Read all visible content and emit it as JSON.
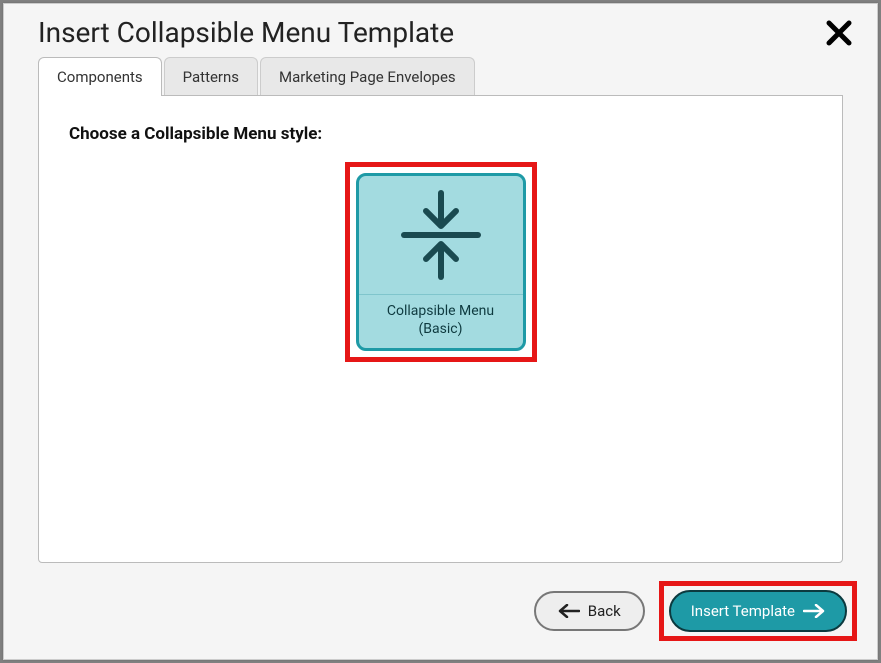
{
  "dialog": {
    "title": "Insert Collapsible Menu Template"
  },
  "tabs": [
    {
      "label": "Components"
    },
    {
      "label": "Patterns"
    },
    {
      "label": "Marketing Page Envelopes"
    }
  ],
  "panel": {
    "heading": "Choose a Collapsible Menu style:"
  },
  "option": {
    "label_line1": "Collapsible Menu",
    "label_line2": "(Basic)"
  },
  "footer": {
    "back_label": "Back",
    "insert_label": "Insert Template"
  },
  "colors": {
    "highlight": "#e61717",
    "accent": "#1e9aa6",
    "accentFill": "#a3dbe0"
  }
}
